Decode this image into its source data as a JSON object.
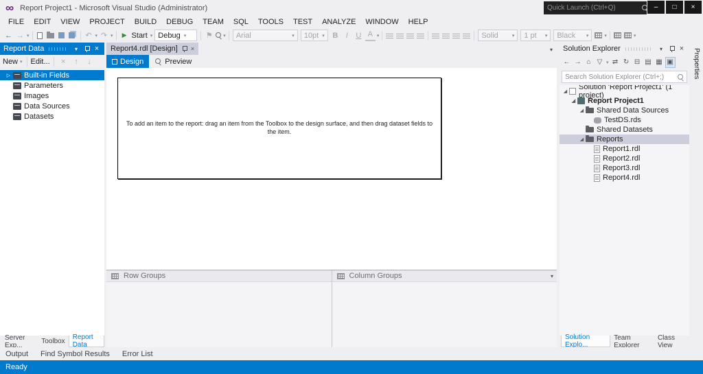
{
  "window": {
    "title": "Report Project1 - Microsoft Visual Studio (Administrator)",
    "quick_launch_placeholder": "Quick Launch (Ctrl+Q)"
  },
  "menu": {
    "items": [
      "FILE",
      "EDIT",
      "VIEW",
      "PROJECT",
      "BUILD",
      "DEBUG",
      "TEAM",
      "SQL",
      "TOOLS",
      "TEST",
      "ANALYZE",
      "WINDOW",
      "HELP"
    ]
  },
  "toolbar": {
    "start_label": "Start",
    "debug_value": "Debug",
    "font_value": "Arial",
    "font_size_value": "10pt",
    "border_style_value": "Solid",
    "border_width_value": "1 pt",
    "border_color_value": "Black",
    "bold": "B",
    "italic": "I",
    "underline": "U",
    "color_a": "A"
  },
  "report_data": {
    "title": "Report Data",
    "new_label": "New",
    "edit_label": "Edit...",
    "items": [
      {
        "label": "Built-in Fields"
      },
      {
        "label": "Parameters"
      },
      {
        "label": "Images"
      },
      {
        "label": "Data Sources"
      },
      {
        "label": "Datasets"
      }
    ],
    "tabs": [
      "Server Exp...",
      "Toolbox",
      "Report Data"
    ]
  },
  "document": {
    "tab_label": "Report4.rdl [Design]",
    "design_label": "Design",
    "preview_label": "Preview",
    "hint": "To add an item to the report: drag an item from the Toolbox to the design surface, and then drag dataset fields to the item.",
    "row_groups_label": "Row Groups",
    "column_groups_label": "Column Groups"
  },
  "solution_explorer": {
    "title": "Solution Explorer",
    "search_placeholder": "Search Solution Explorer (Ctrl+;)",
    "items": [
      {
        "label": "Solution 'Report Project1' (1 project)"
      },
      {
        "label": "Report Project1"
      },
      {
        "label": "Shared Data Sources"
      },
      {
        "label": "TestDS.rds"
      },
      {
        "label": "Shared Datasets"
      },
      {
        "label": "Reports"
      },
      {
        "label": "Report1.rdl"
      },
      {
        "label": "Report2.rdl"
      },
      {
        "label": "Report3.rdl"
      },
      {
        "label": "Report4.rdl"
      }
    ],
    "tabs": [
      "Solution Explo...",
      "Team Explorer",
      "Class View"
    ]
  },
  "properties_tab_label": "Properties",
  "bottom_tabs": [
    "Output",
    "Find Symbol Results",
    "Error List"
  ],
  "status": {
    "text": "Ready"
  },
  "icons": {
    "logo": "∞",
    "back": "←",
    "forward": "→",
    "dropdown": "▾",
    "undo": "↶",
    "redo": "↷",
    "play": "▶",
    "close": "×",
    "delete": "×",
    "up": "↑",
    "down": "↓",
    "collapsed": "▷",
    "expanded": "◢",
    "home": "⌂",
    "refresh": "↻",
    "sync": "⇄",
    "collapse_all": "⊟",
    "window_icon": "▤",
    "show_all": "▦",
    "preview_sel": "▣",
    "filter": "▽",
    "flag": "⚑",
    "minimize": "–",
    "maximize": "□"
  },
  "colors": {
    "accent": "#007ACC",
    "inactive_selection": "#CCCEDB",
    "chrome": "#EFEFF2",
    "status_bar": "#007ACC"
  }
}
